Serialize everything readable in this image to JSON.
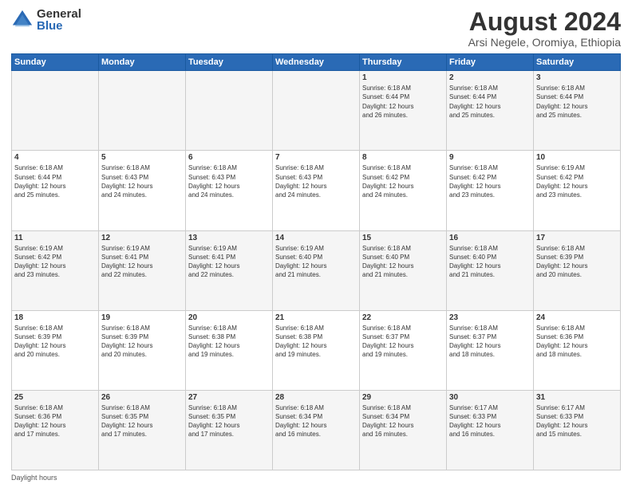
{
  "logo": {
    "general": "General",
    "blue": "Blue"
  },
  "title": "August 2024",
  "subtitle": "Arsi Negele, Oromiya, Ethiopia",
  "days_of_week": [
    "Sunday",
    "Monday",
    "Tuesday",
    "Wednesday",
    "Thursday",
    "Friday",
    "Saturday"
  ],
  "footer": "Daylight hours",
  "weeks": [
    [
      {
        "day": "",
        "info": ""
      },
      {
        "day": "",
        "info": ""
      },
      {
        "day": "",
        "info": ""
      },
      {
        "day": "",
        "info": ""
      },
      {
        "day": "1",
        "info": "Sunrise: 6:18 AM\nSunset: 6:44 PM\nDaylight: 12 hours\nand 26 minutes."
      },
      {
        "day": "2",
        "info": "Sunrise: 6:18 AM\nSunset: 6:44 PM\nDaylight: 12 hours\nand 25 minutes."
      },
      {
        "day": "3",
        "info": "Sunrise: 6:18 AM\nSunset: 6:44 PM\nDaylight: 12 hours\nand 25 minutes."
      }
    ],
    [
      {
        "day": "4",
        "info": "Sunrise: 6:18 AM\nSunset: 6:44 PM\nDaylight: 12 hours\nand 25 minutes."
      },
      {
        "day": "5",
        "info": "Sunrise: 6:18 AM\nSunset: 6:43 PM\nDaylight: 12 hours\nand 24 minutes."
      },
      {
        "day": "6",
        "info": "Sunrise: 6:18 AM\nSunset: 6:43 PM\nDaylight: 12 hours\nand 24 minutes."
      },
      {
        "day": "7",
        "info": "Sunrise: 6:18 AM\nSunset: 6:43 PM\nDaylight: 12 hours\nand 24 minutes."
      },
      {
        "day": "8",
        "info": "Sunrise: 6:18 AM\nSunset: 6:42 PM\nDaylight: 12 hours\nand 24 minutes."
      },
      {
        "day": "9",
        "info": "Sunrise: 6:18 AM\nSunset: 6:42 PM\nDaylight: 12 hours\nand 23 minutes."
      },
      {
        "day": "10",
        "info": "Sunrise: 6:19 AM\nSunset: 6:42 PM\nDaylight: 12 hours\nand 23 minutes."
      }
    ],
    [
      {
        "day": "11",
        "info": "Sunrise: 6:19 AM\nSunset: 6:42 PM\nDaylight: 12 hours\nand 23 minutes."
      },
      {
        "day": "12",
        "info": "Sunrise: 6:19 AM\nSunset: 6:41 PM\nDaylight: 12 hours\nand 22 minutes."
      },
      {
        "day": "13",
        "info": "Sunrise: 6:19 AM\nSunset: 6:41 PM\nDaylight: 12 hours\nand 22 minutes."
      },
      {
        "day": "14",
        "info": "Sunrise: 6:19 AM\nSunset: 6:40 PM\nDaylight: 12 hours\nand 21 minutes."
      },
      {
        "day": "15",
        "info": "Sunrise: 6:18 AM\nSunset: 6:40 PM\nDaylight: 12 hours\nand 21 minutes."
      },
      {
        "day": "16",
        "info": "Sunrise: 6:18 AM\nSunset: 6:40 PM\nDaylight: 12 hours\nand 21 minutes."
      },
      {
        "day": "17",
        "info": "Sunrise: 6:18 AM\nSunset: 6:39 PM\nDaylight: 12 hours\nand 20 minutes."
      }
    ],
    [
      {
        "day": "18",
        "info": "Sunrise: 6:18 AM\nSunset: 6:39 PM\nDaylight: 12 hours\nand 20 minutes."
      },
      {
        "day": "19",
        "info": "Sunrise: 6:18 AM\nSunset: 6:39 PM\nDaylight: 12 hours\nand 20 minutes."
      },
      {
        "day": "20",
        "info": "Sunrise: 6:18 AM\nSunset: 6:38 PM\nDaylight: 12 hours\nand 19 minutes."
      },
      {
        "day": "21",
        "info": "Sunrise: 6:18 AM\nSunset: 6:38 PM\nDaylight: 12 hours\nand 19 minutes."
      },
      {
        "day": "22",
        "info": "Sunrise: 6:18 AM\nSunset: 6:37 PM\nDaylight: 12 hours\nand 19 minutes."
      },
      {
        "day": "23",
        "info": "Sunrise: 6:18 AM\nSunset: 6:37 PM\nDaylight: 12 hours\nand 18 minutes."
      },
      {
        "day": "24",
        "info": "Sunrise: 6:18 AM\nSunset: 6:36 PM\nDaylight: 12 hours\nand 18 minutes."
      }
    ],
    [
      {
        "day": "25",
        "info": "Sunrise: 6:18 AM\nSunset: 6:36 PM\nDaylight: 12 hours\nand 17 minutes."
      },
      {
        "day": "26",
        "info": "Sunrise: 6:18 AM\nSunset: 6:35 PM\nDaylight: 12 hours\nand 17 minutes."
      },
      {
        "day": "27",
        "info": "Sunrise: 6:18 AM\nSunset: 6:35 PM\nDaylight: 12 hours\nand 17 minutes."
      },
      {
        "day": "28",
        "info": "Sunrise: 6:18 AM\nSunset: 6:34 PM\nDaylight: 12 hours\nand 16 minutes."
      },
      {
        "day": "29",
        "info": "Sunrise: 6:18 AM\nSunset: 6:34 PM\nDaylight: 12 hours\nand 16 minutes."
      },
      {
        "day": "30",
        "info": "Sunrise: 6:17 AM\nSunset: 6:33 PM\nDaylight: 12 hours\nand 16 minutes."
      },
      {
        "day": "31",
        "info": "Sunrise: 6:17 AM\nSunset: 6:33 PM\nDaylight: 12 hours\nand 15 minutes."
      }
    ]
  ]
}
